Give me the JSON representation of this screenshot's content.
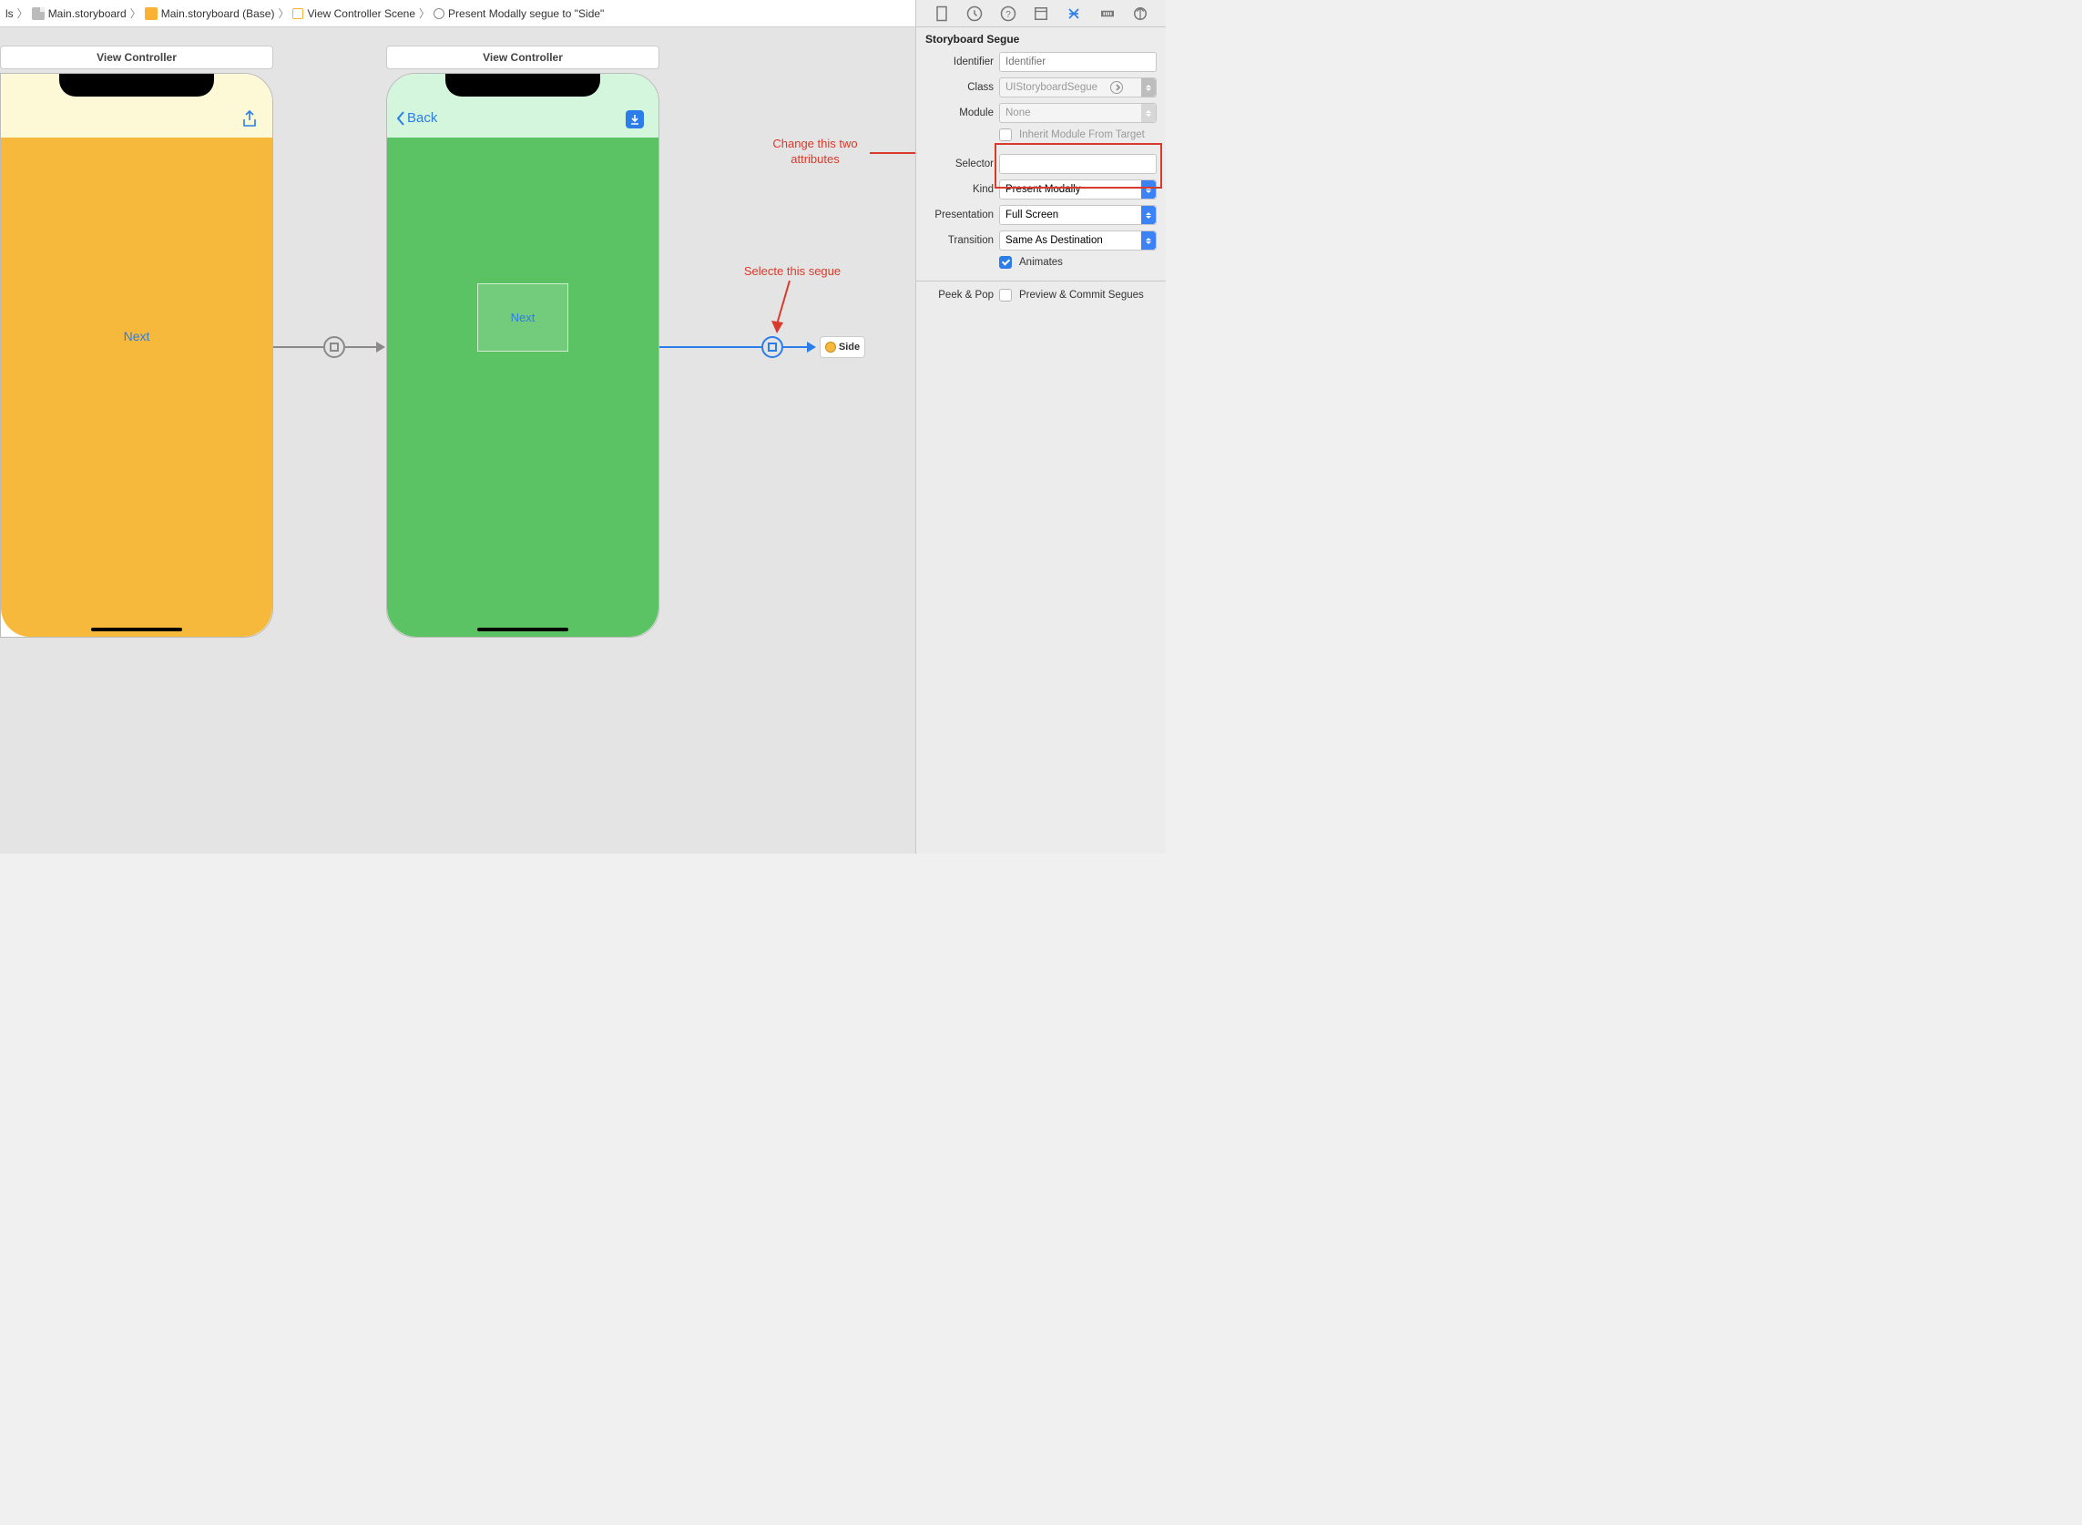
{
  "breadcrumb": {
    "level0": "ls",
    "level1": "Main.storyboard",
    "level2": "Main.storyboard (Base)",
    "level3": "View Controller Scene",
    "level4": "Present Modally segue to \"Side\""
  },
  "canvas": {
    "vc1_title": "View Controller",
    "vc1_next": "Next",
    "vc2_title": "View Controller",
    "vc2_back": "Back",
    "vc2_containerNext": "Next",
    "side_ref": "Side"
  },
  "annotations": {
    "attrs_line1": "Change this two",
    "attrs_line2": "attributes",
    "select_segue": "Selecte this segue"
  },
  "inspector": {
    "section": "Storyboard Segue",
    "identifier_label": "Identifier",
    "identifier_placeholder": "Identifier",
    "class_label": "Class",
    "class_value": "UIStoryboardSegue",
    "module_label": "Module",
    "module_value": "None",
    "inherit_label": "Inherit Module From Target",
    "selector_label": "Selector",
    "kind_label": "Kind",
    "kind_value": "Present Modally",
    "presentation_label": "Presentation",
    "presentation_value": "Full Screen",
    "transition_label": "Transition",
    "transition_value": "Same As Destination",
    "animates_label": "Animates",
    "peek_label": "Peek & Pop",
    "peek_value": "Preview & Commit Segues"
  }
}
